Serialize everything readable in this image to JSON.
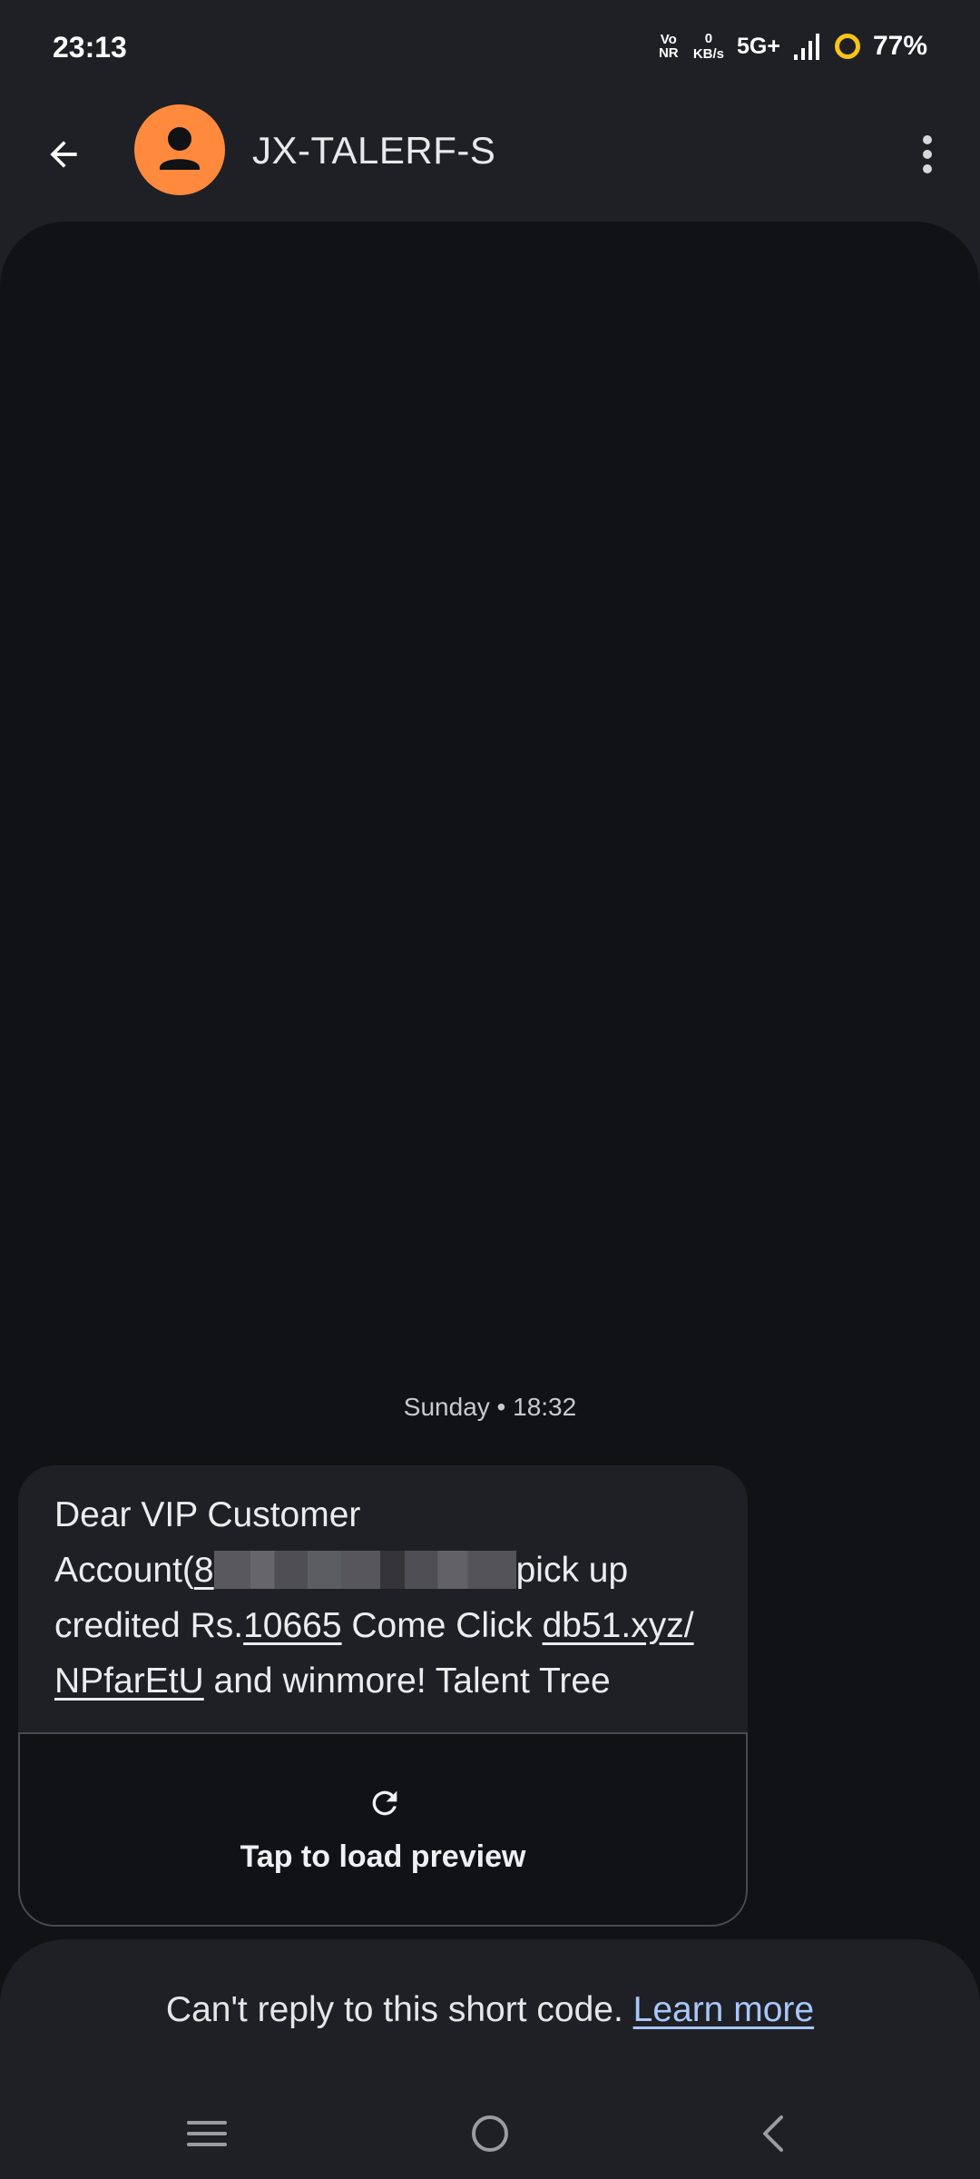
{
  "status_bar": {
    "time": "23:13",
    "volte_top": "Vo",
    "volte_bottom": "NR",
    "net_speed_value": "0",
    "net_speed_unit": "KB/s",
    "network_type": "5G+",
    "battery_percent": "77%"
  },
  "header": {
    "contact_name": "JX-TALERF-S",
    "avatar_color": "#ff8a3d"
  },
  "conversation": {
    "timestamp": "Sunday • 18:32",
    "message": {
      "line1": "Dear VIP Customer",
      "account_prefix": "Account(",
      "account_visible": "8",
      "account_suffix": "pick up",
      "line3_prefix": "credited Rs.",
      "amount": "10665",
      "line3_middle": " Come Click ",
      "link_part1": "db51.xyz/",
      "link_part2": "NPfarEtU",
      "line4_suffix": " and winmore! Talent Tree"
    },
    "preview_label": "Tap to load preview"
  },
  "reply_sheet": {
    "text": "Can't reply to this short code. ",
    "link": "Learn more",
    "link_color": "#a8c7fa"
  },
  "icons": {
    "back": "arrow-back-icon",
    "more": "more-vert-icon",
    "refresh": "refresh-icon",
    "nav_recents": "recents-icon",
    "nav_home": "home-icon",
    "nav_back": "nav-back-icon"
  }
}
